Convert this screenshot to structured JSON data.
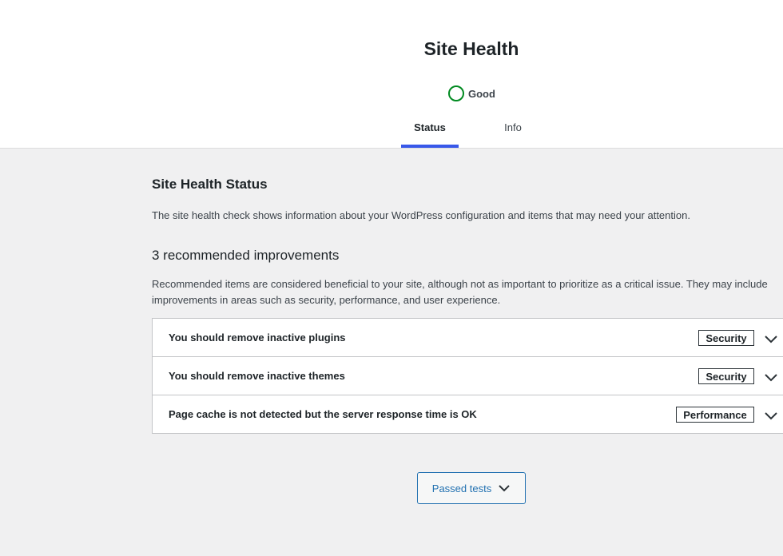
{
  "header": {
    "title": "Site Health",
    "status_label": "Good",
    "status_color": "#008a20",
    "tabs": [
      {
        "label": "Status",
        "active": true
      },
      {
        "label": "Info",
        "active": false
      }
    ],
    "active_tab_color": "#3858e9"
  },
  "main": {
    "section_title": "Site Health Status",
    "intro": "The site health check shows information about your WordPress configuration and items that may need your attention.",
    "count_title": "3 recommended improvements",
    "count_description": "Recommended items are considered beneficial to your site, although not as important to prioritize as a critical issue. They may include improvements in areas such as security, performance, and user experience.",
    "issues": [
      {
        "title": "You should remove inactive plugins",
        "badge": "Security",
        "icon": "chevron-down-icon"
      },
      {
        "title": "You should remove inactive themes",
        "badge": "Security",
        "icon": "chevron-down-icon"
      },
      {
        "title": "Page cache is not detected but the server response time is OK",
        "badge": "Performance",
        "icon": "chevron-down-icon"
      }
    ],
    "passed_tests_label": "Passed tests",
    "link_color": "#2271b1"
  }
}
